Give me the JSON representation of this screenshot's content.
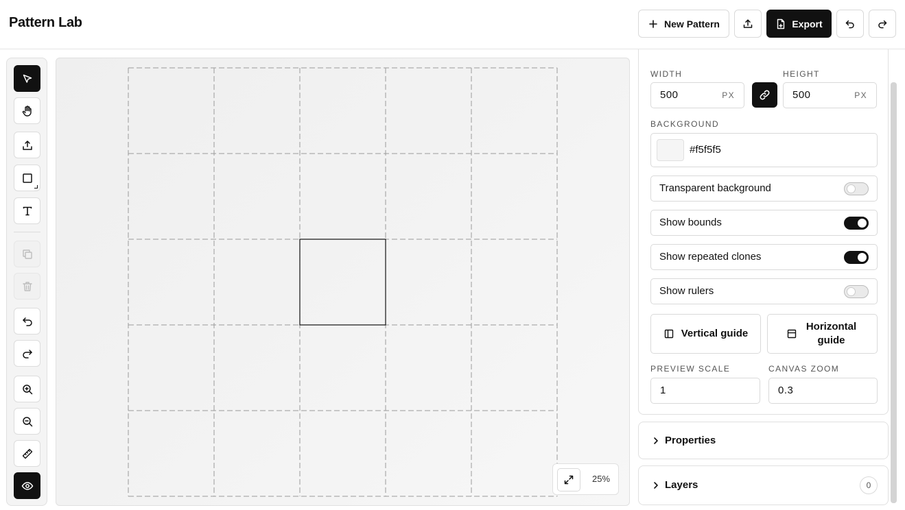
{
  "app": {
    "title": "Pattern Lab"
  },
  "header": {
    "new_pattern_label": "New Pattern",
    "export_label": "Export"
  },
  "toolbar": {
    "tools": [
      "select",
      "pan",
      "upload",
      "rectangle",
      "text",
      "duplicate",
      "delete",
      "undo",
      "redo",
      "zoom-in",
      "zoom-out",
      "ruler",
      "preview"
    ],
    "active": [
      "select",
      "preview"
    ],
    "disabled": [
      "duplicate",
      "delete"
    ]
  },
  "canvas": {
    "zoom_label": "25%",
    "grid_columns": 5,
    "grid_rows": 5
  },
  "settings": {
    "width_label": "WIDTH",
    "width_value": "500",
    "width_unit": "PX",
    "height_label": "HEIGHT",
    "height_value": "500",
    "height_unit": "PX",
    "background_label": "BACKGROUND",
    "background_value": "#f5f5f5",
    "transparent_background": {
      "label": "Transparent background",
      "on": false
    },
    "show_bounds": {
      "label": "Show bounds",
      "on": true
    },
    "show_repeated_clones": {
      "label": "Show repeated clones",
      "on": true
    },
    "show_rulers": {
      "label": "Show rulers",
      "on": false
    },
    "vertical_guide_label": "Vertical guide",
    "horizontal_guide_label": "Horizontal guide",
    "preview_scale_label": "PREVIEW SCALE",
    "preview_scale_value": "1",
    "canvas_zoom_label": "CANVAS ZOOM",
    "canvas_zoom_value": "0.3"
  },
  "sections": {
    "properties_label": "Properties",
    "layers_label": "Layers",
    "layers_count": "0"
  },
  "colors": {
    "accent": "#111111",
    "border": "#d9d9d9",
    "canvas_bg": "#f1f1f1"
  }
}
